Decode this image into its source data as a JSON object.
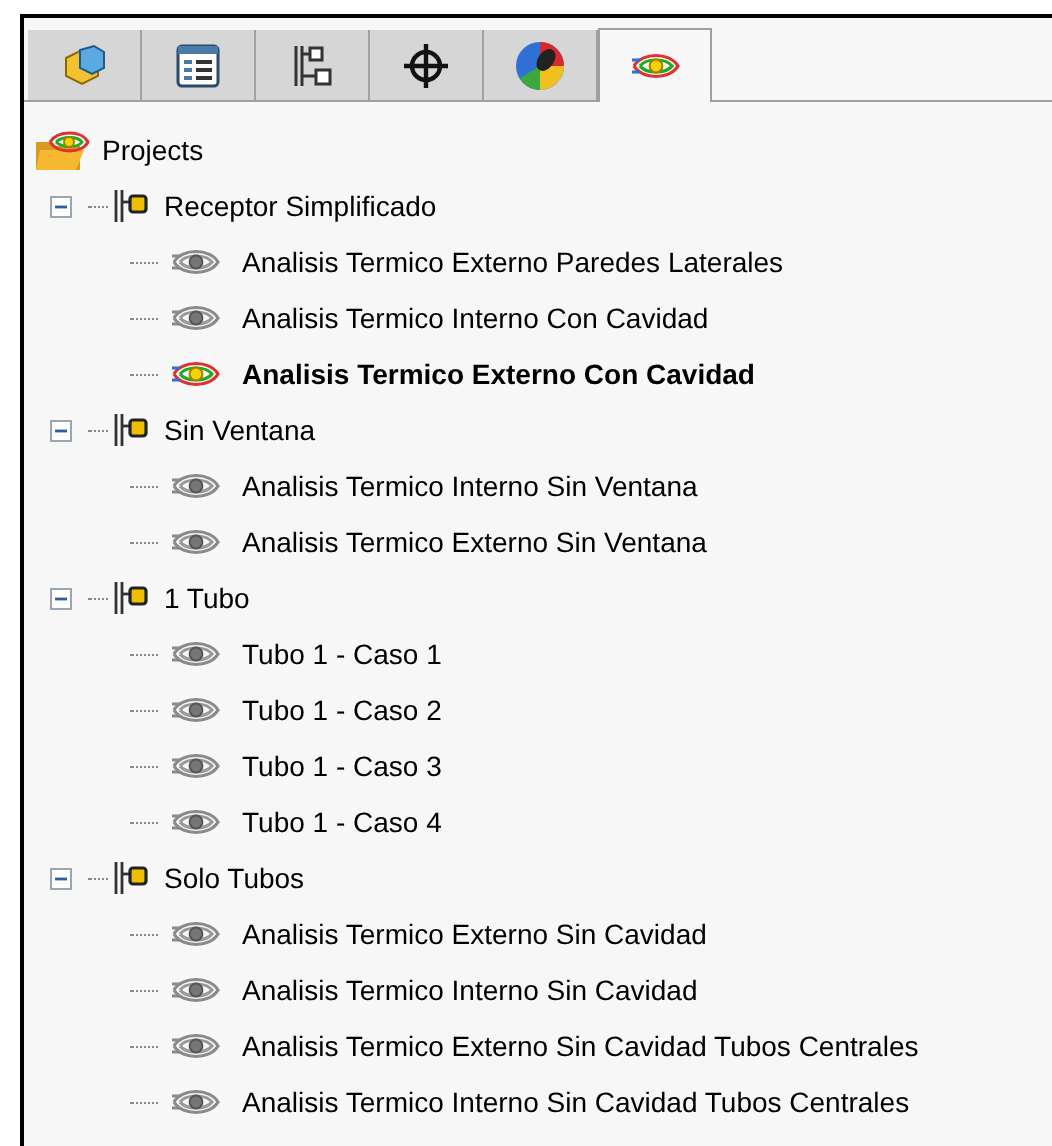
{
  "tabs": [
    {
      "kind": "part",
      "selected": false
    },
    {
      "kind": "properties",
      "selected": false
    },
    {
      "kind": "config",
      "selected": false
    },
    {
      "kind": "origin",
      "selected": false
    },
    {
      "kind": "appearance",
      "selected": false
    },
    {
      "kind": "simulation",
      "selected": true
    }
  ],
  "tree": {
    "label": "Projects",
    "children": [
      {
        "label": "Receptor Simplificado",
        "expanded": true,
        "children": [
          {
            "label": "Analisis Termico Externo Paredes Laterales",
            "active": false
          },
          {
            "label": "Analisis Termico Interno Con Cavidad",
            "active": false
          },
          {
            "label": "Analisis Termico Externo Con Cavidad",
            "active": true
          }
        ]
      },
      {
        "label": "Sin Ventana",
        "expanded": true,
        "children": [
          {
            "label": "Analisis Termico Interno Sin Ventana",
            "active": false
          },
          {
            "label": "Analisis Termico Externo Sin Ventana",
            "active": false
          }
        ]
      },
      {
        "label": "1 Tubo",
        "expanded": true,
        "children": [
          {
            "label": "Tubo 1 - Caso 1",
            "active": false
          },
          {
            "label": "Tubo 1 - Caso 2",
            "active": false
          },
          {
            "label": "Tubo 1 - Caso 3",
            "active": false
          },
          {
            "label": "Tubo 1 - Caso 4",
            "active": false
          }
        ]
      },
      {
        "label": "Solo Tubos",
        "expanded": true,
        "children": [
          {
            "label": "Analisis Termico Externo Sin Cavidad",
            "active": false
          },
          {
            "label": "Analisis Termico Interno Sin Cavidad",
            "active": false
          },
          {
            "label": "Analisis Termico Externo Sin Cavidad Tubos Centrales",
            "active": false
          },
          {
            "label": "Analisis Termico Interno Sin Cavidad Tubos Centrales",
            "active": false
          }
        ]
      }
    ]
  }
}
